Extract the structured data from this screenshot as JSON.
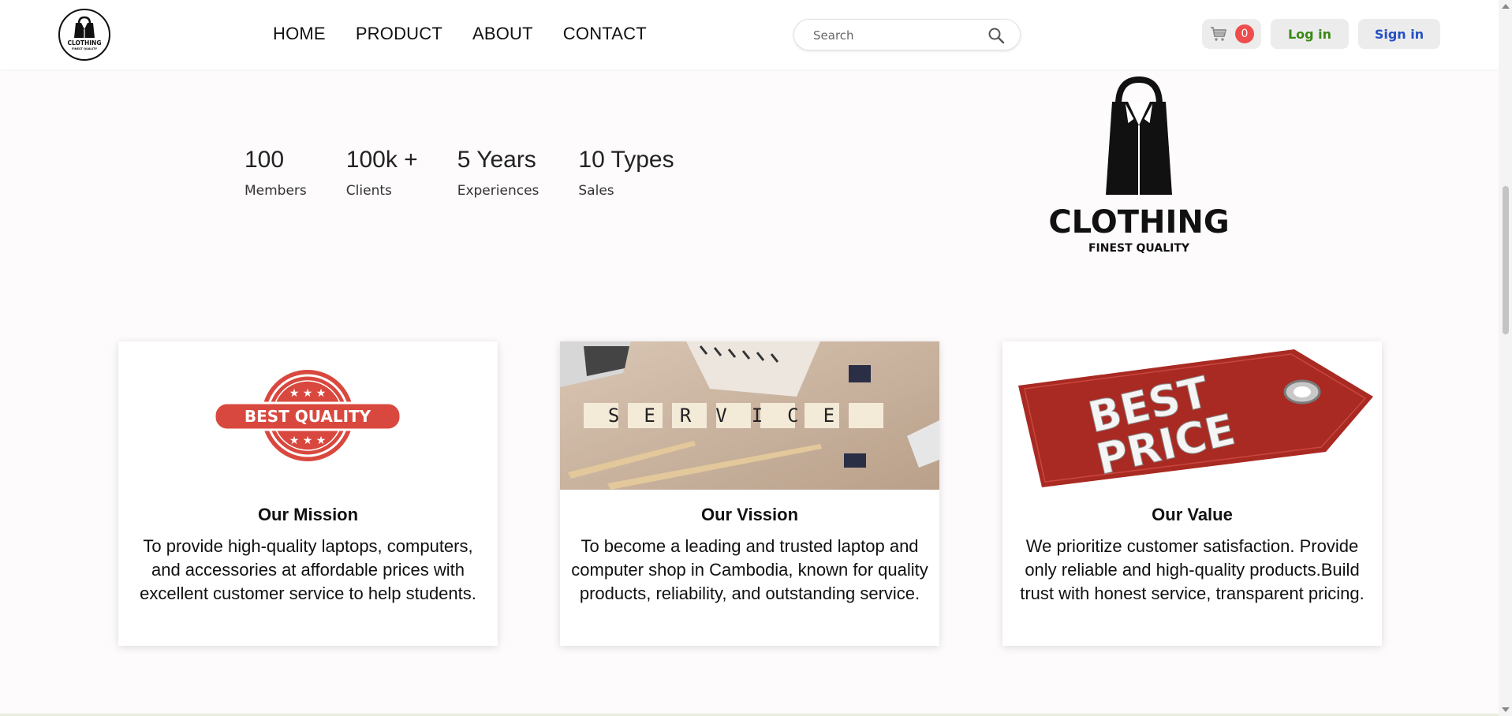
{
  "header": {
    "logo_icon": "clothing-bag-logo-icon",
    "logo_text": "CLOTHING",
    "logo_subtext": "FINEST QUALITY",
    "nav": [
      {
        "label": "HOME"
      },
      {
        "label": "PRODUCT"
      },
      {
        "label": "ABOUT"
      },
      {
        "label": "CONTACT"
      }
    ],
    "search": {
      "placeholder": "Search",
      "icon": "search-icon"
    },
    "cart": {
      "icon": "cart-icon",
      "count": "0",
      "badge_color": "#ef4d4d"
    },
    "login_label": "Log in",
    "signin_label": "Sign in",
    "login_color": "#3b8a14",
    "signin_color": "#2350c4"
  },
  "stats": [
    {
      "value": "100",
      "label": "Members"
    },
    {
      "value": "100k +",
      "label": "Clients"
    },
    {
      "value": "5 Years",
      "label": "Experiences"
    },
    {
      "value": "10 Types",
      "label": "Sales"
    }
  ],
  "brand": {
    "name": "CLOTHING",
    "tagline": "FINEST QUALITY"
  },
  "cards": [
    {
      "image": "best-quality-badge",
      "image_text": "BEST QUALITY",
      "title": "Our Mission",
      "text": "To provide high-quality laptops, computers, and accessories at affordable prices with excellent customer service to help students."
    },
    {
      "image": "service-letter-tiles",
      "image_text": "SERVICE",
      "title": "Our Vission",
      "text": "To become a leading and trusted laptop and computer shop in Cambodia, known for quality products, reliability, and outstanding service."
    },
    {
      "image": "best-price-tag",
      "image_text_line1": "BEST",
      "image_text_line2": "PRICE",
      "title": "Our Value",
      "text": "We prioritize customer satisfaction. Provide only reliable and high-quality products.Build trust with honest service, transparent pricing."
    }
  ]
}
